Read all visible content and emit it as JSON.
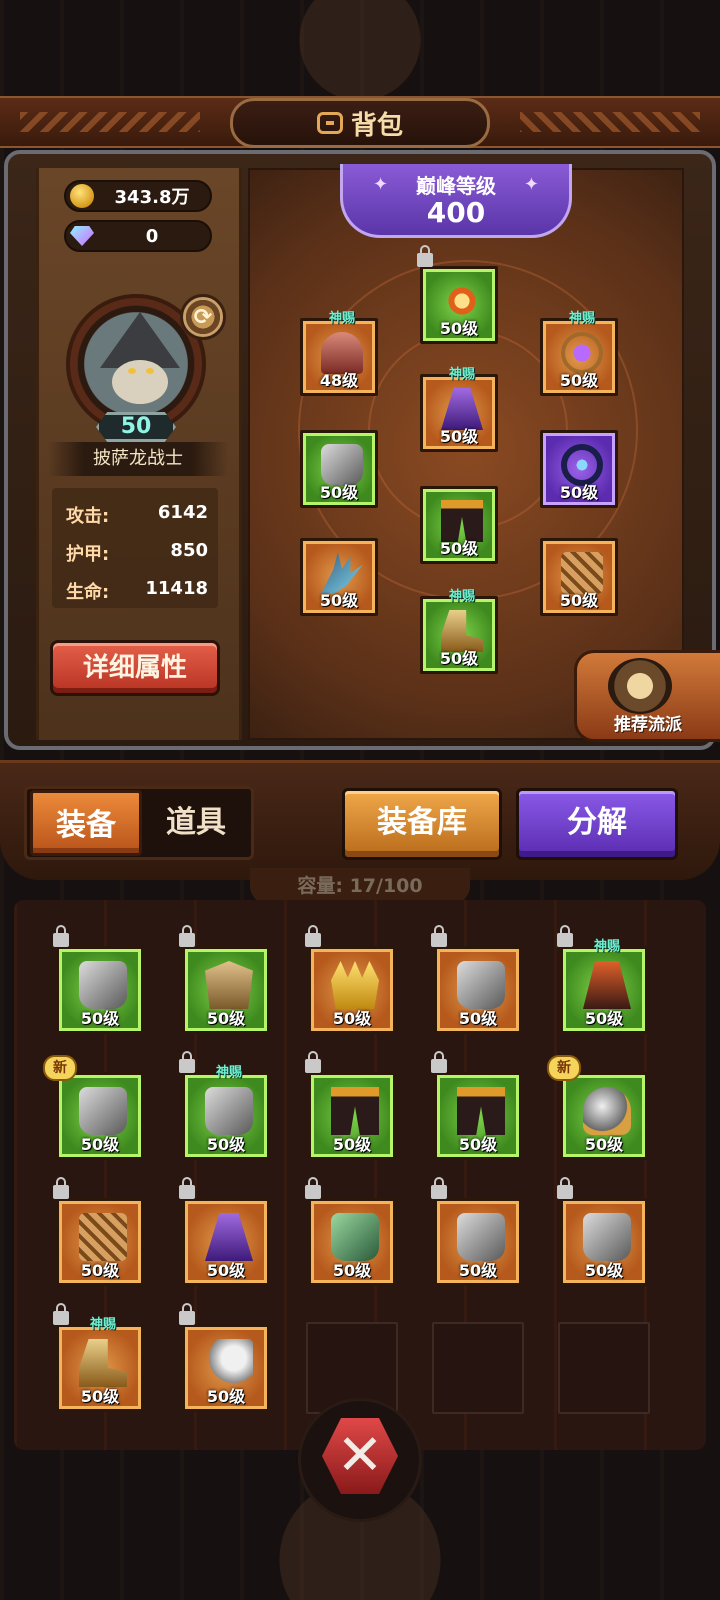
{
  "header": {
    "title": "背包"
  },
  "currency": {
    "gold": "343.8万",
    "gems": "0"
  },
  "hero": {
    "level": "50",
    "name": "披萨龙战士",
    "stats": [
      {
        "label": "攻击:",
        "value": "6142"
      },
      {
        "label": "护甲:",
        "value": "850"
      },
      {
        "label": "生命:",
        "value": "11418"
      }
    ],
    "detail_button": "详细属性"
  },
  "peak": {
    "label": "巅峰等级",
    "value": "400"
  },
  "equipped": [
    {
      "level": "50级",
      "tag": "",
      "locked": true,
      "rarity": "green",
      "icon": "sun-emblem-icon"
    },
    {
      "level": "48级",
      "tag": "神赐",
      "locked": false,
      "rarity": "orange",
      "icon": "helmet-icon"
    },
    {
      "level": "50级",
      "tag": "神赐",
      "locked": false,
      "rarity": "orange",
      "icon": "amulet-icon"
    },
    {
      "level": "50级",
      "tag": "神赐",
      "locked": false,
      "rarity": "orange",
      "icon": "cape-icon"
    },
    {
      "level": "50级",
      "tag": "",
      "locked": false,
      "rarity": "green",
      "icon": "gauntlet-icon"
    },
    {
      "level": "50级",
      "tag": "",
      "locked": false,
      "rarity": "purple",
      "icon": "ring-icon"
    },
    {
      "level": "50级",
      "tag": "",
      "locked": false,
      "rarity": "green",
      "icon": "leg-armor-icon"
    },
    {
      "level": "50级",
      "tag": "",
      "locked": false,
      "rarity": "orange",
      "icon": "claw-weapon-icon"
    },
    {
      "level": "50级",
      "tag": "",
      "locked": false,
      "rarity": "orange",
      "icon": "bracer-icon"
    },
    {
      "level": "50级",
      "tag": "神赐",
      "locked": false,
      "rarity": "green",
      "icon": "boots-icon"
    }
  ],
  "recommend": {
    "label": "推荐流派"
  },
  "tabs": {
    "equipment": "装备",
    "items": "道具"
  },
  "buttons": {
    "armory": "装备库",
    "decompose": "分解"
  },
  "capacity": "容量: 17/100",
  "inventory": [
    {
      "level": "50级",
      "tag": "",
      "locked": true,
      "is_new": false,
      "rarity": "green",
      "icon": "gauntlet-icon"
    },
    {
      "level": "50级",
      "tag": "",
      "locked": true,
      "is_new": false,
      "rarity": "green",
      "icon": "chest-armor-icon"
    },
    {
      "level": "50级",
      "tag": "",
      "locked": true,
      "is_new": false,
      "rarity": "orange",
      "icon": "crown-icon"
    },
    {
      "level": "50级",
      "tag": "",
      "locked": true,
      "is_new": false,
      "rarity": "orange",
      "icon": "gauntlet-icon"
    },
    {
      "level": "50级",
      "tag": "神赐",
      "locked": true,
      "is_new": false,
      "rarity": "green",
      "icon": "robe-icon"
    },
    {
      "level": "50级",
      "tag": "",
      "locked": false,
      "is_new": true,
      "new_label": "新",
      "rarity": "green",
      "icon": "gauntlet-icon"
    },
    {
      "level": "50级",
      "tag": "神赐",
      "locked": true,
      "is_new": false,
      "rarity": "green",
      "icon": "gauntlet-icon"
    },
    {
      "level": "50级",
      "tag": "",
      "locked": true,
      "is_new": false,
      "rarity": "green",
      "icon": "leg-armor-icon"
    },
    {
      "level": "50级",
      "tag": "",
      "locked": true,
      "is_new": false,
      "rarity": "green",
      "icon": "leg-armor-icon"
    },
    {
      "level": "50级",
      "tag": "",
      "locked": false,
      "is_new": true,
      "new_label": "新",
      "rarity": "green",
      "icon": "shoulder-armor-icon"
    },
    {
      "level": "50级",
      "tag": "",
      "locked": true,
      "is_new": false,
      "rarity": "orange",
      "icon": "bracer-icon"
    },
    {
      "level": "50级",
      "tag": "",
      "locked": true,
      "is_new": false,
      "rarity": "orange",
      "icon": "cape-icon"
    },
    {
      "level": "50级",
      "tag": "",
      "locked": true,
      "is_new": false,
      "rarity": "orange",
      "icon": "green-gauntlet-icon"
    },
    {
      "level": "50级",
      "tag": "",
      "locked": true,
      "is_new": false,
      "rarity": "orange",
      "icon": "gauntlet-icon"
    },
    {
      "level": "50级",
      "tag": "",
      "locked": true,
      "is_new": false,
      "rarity": "orange",
      "icon": "gauntlet-icon"
    },
    {
      "level": "50级",
      "tag": "神赐",
      "locked": true,
      "is_new": false,
      "rarity": "orange",
      "icon": "boots-icon"
    },
    {
      "level": "50级",
      "tag": "",
      "locked": true,
      "is_new": false,
      "rarity": "orange",
      "icon": "wing-icon"
    }
  ],
  "close": {
    "icon": "close-icon",
    "glyph": "✕"
  }
}
